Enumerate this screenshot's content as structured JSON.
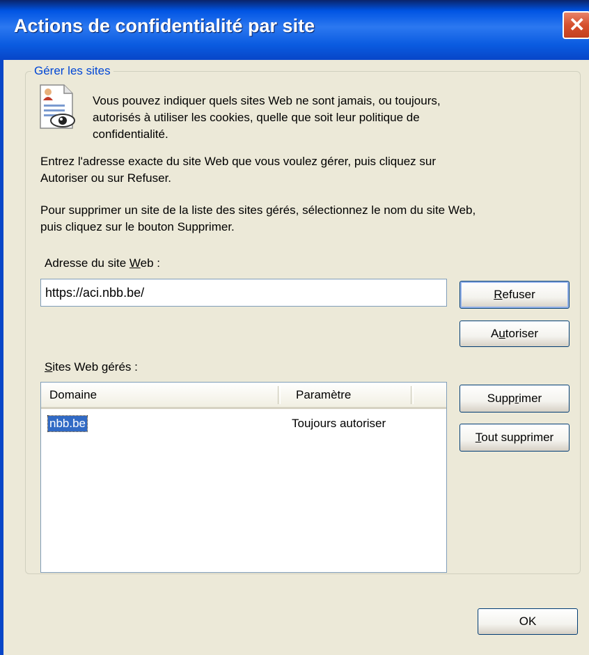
{
  "window": {
    "title": "Actions de confidentialité par site",
    "close_label": "✕"
  },
  "group": {
    "label": "Gérer les sites",
    "intro_lines": [
      "Vous pouvez indiquer quels sites Web ne sont jamais, ou toujours,",
      "autorisés à utiliser les cookies, quelle que soit leur politique de",
      "confidentialité."
    ],
    "instructions1_lines": [
      "Entrez l'adresse exacte du site Web que vous voulez gérer, puis cliquez sur",
      "Autoriser ou sur Refuser."
    ],
    "instructions2_lines": [
      "Pour supprimer un site de la liste des sites gérés, sélectionnez le nom du site Web,",
      "puis cliquez sur le bouton Supprimer."
    ],
    "address_label_pre": "Adresse du site ",
    "address_label_key": "W",
    "address_label_post": "eb :",
    "address_value": "https://aci.nbb.be/",
    "managed_label_key": "S",
    "managed_label_post": "ites Web gérés :"
  },
  "buttons": {
    "refuse_key": "R",
    "refuse_rest": "efuser",
    "allow_pre": "A",
    "allow_key": "u",
    "allow_rest": "toriser",
    "remove_pre": "Supp",
    "remove_key": "r",
    "remove_rest": "imer",
    "remove_all_key": "T",
    "remove_all_rest": "out supprimer",
    "ok": "OK"
  },
  "table": {
    "headers": [
      "Domaine",
      "Paramètre"
    ],
    "rows": [
      {
        "domain": "nbb.be",
        "setting": "Toujours autoriser",
        "selected": true
      }
    ]
  }
}
